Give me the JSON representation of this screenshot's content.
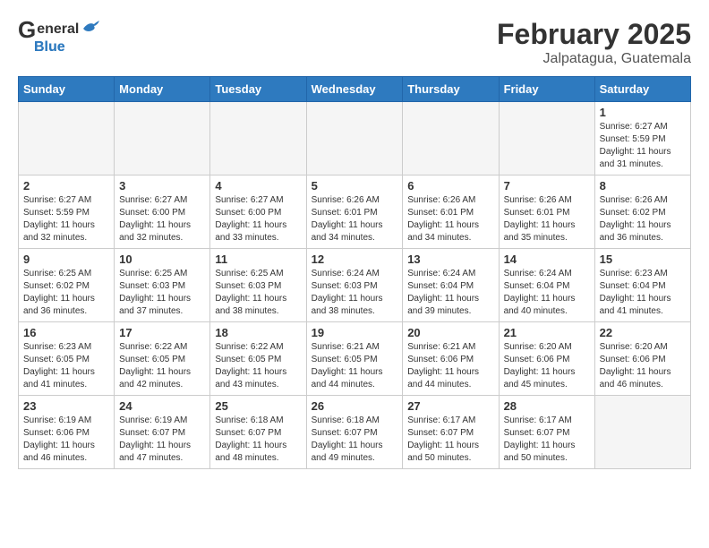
{
  "header": {
    "logo_general": "General",
    "logo_blue": "Blue",
    "month_year": "February 2025",
    "location": "Jalpatagua, Guatemala"
  },
  "days_of_week": [
    "Sunday",
    "Monday",
    "Tuesday",
    "Wednesday",
    "Thursday",
    "Friday",
    "Saturday"
  ],
  "weeks": [
    [
      {
        "day": "",
        "info": ""
      },
      {
        "day": "",
        "info": ""
      },
      {
        "day": "",
        "info": ""
      },
      {
        "day": "",
        "info": ""
      },
      {
        "day": "",
        "info": ""
      },
      {
        "day": "",
        "info": ""
      },
      {
        "day": "1",
        "info": "Sunrise: 6:27 AM\nSunset: 5:59 PM\nDaylight: 11 hours\nand 31 minutes."
      }
    ],
    [
      {
        "day": "2",
        "info": "Sunrise: 6:27 AM\nSunset: 5:59 PM\nDaylight: 11 hours\nand 32 minutes."
      },
      {
        "day": "3",
        "info": "Sunrise: 6:27 AM\nSunset: 6:00 PM\nDaylight: 11 hours\nand 32 minutes."
      },
      {
        "day": "4",
        "info": "Sunrise: 6:27 AM\nSunset: 6:00 PM\nDaylight: 11 hours\nand 33 minutes."
      },
      {
        "day": "5",
        "info": "Sunrise: 6:26 AM\nSunset: 6:01 PM\nDaylight: 11 hours\nand 34 minutes."
      },
      {
        "day": "6",
        "info": "Sunrise: 6:26 AM\nSunset: 6:01 PM\nDaylight: 11 hours\nand 34 minutes."
      },
      {
        "day": "7",
        "info": "Sunrise: 6:26 AM\nSunset: 6:01 PM\nDaylight: 11 hours\nand 35 minutes."
      },
      {
        "day": "8",
        "info": "Sunrise: 6:26 AM\nSunset: 6:02 PM\nDaylight: 11 hours\nand 36 minutes."
      }
    ],
    [
      {
        "day": "9",
        "info": "Sunrise: 6:25 AM\nSunset: 6:02 PM\nDaylight: 11 hours\nand 36 minutes."
      },
      {
        "day": "10",
        "info": "Sunrise: 6:25 AM\nSunset: 6:03 PM\nDaylight: 11 hours\nand 37 minutes."
      },
      {
        "day": "11",
        "info": "Sunrise: 6:25 AM\nSunset: 6:03 PM\nDaylight: 11 hours\nand 38 minutes."
      },
      {
        "day": "12",
        "info": "Sunrise: 6:24 AM\nSunset: 6:03 PM\nDaylight: 11 hours\nand 38 minutes."
      },
      {
        "day": "13",
        "info": "Sunrise: 6:24 AM\nSunset: 6:04 PM\nDaylight: 11 hours\nand 39 minutes."
      },
      {
        "day": "14",
        "info": "Sunrise: 6:24 AM\nSunset: 6:04 PM\nDaylight: 11 hours\nand 40 minutes."
      },
      {
        "day": "15",
        "info": "Sunrise: 6:23 AM\nSunset: 6:04 PM\nDaylight: 11 hours\nand 41 minutes."
      }
    ],
    [
      {
        "day": "16",
        "info": "Sunrise: 6:23 AM\nSunset: 6:05 PM\nDaylight: 11 hours\nand 41 minutes."
      },
      {
        "day": "17",
        "info": "Sunrise: 6:22 AM\nSunset: 6:05 PM\nDaylight: 11 hours\nand 42 minutes."
      },
      {
        "day": "18",
        "info": "Sunrise: 6:22 AM\nSunset: 6:05 PM\nDaylight: 11 hours\nand 43 minutes."
      },
      {
        "day": "19",
        "info": "Sunrise: 6:21 AM\nSunset: 6:05 PM\nDaylight: 11 hours\nand 44 minutes."
      },
      {
        "day": "20",
        "info": "Sunrise: 6:21 AM\nSunset: 6:06 PM\nDaylight: 11 hours\nand 44 minutes."
      },
      {
        "day": "21",
        "info": "Sunrise: 6:20 AM\nSunset: 6:06 PM\nDaylight: 11 hours\nand 45 minutes."
      },
      {
        "day": "22",
        "info": "Sunrise: 6:20 AM\nSunset: 6:06 PM\nDaylight: 11 hours\nand 46 minutes."
      }
    ],
    [
      {
        "day": "23",
        "info": "Sunrise: 6:19 AM\nSunset: 6:06 PM\nDaylight: 11 hours\nand 46 minutes."
      },
      {
        "day": "24",
        "info": "Sunrise: 6:19 AM\nSunset: 6:07 PM\nDaylight: 11 hours\nand 47 minutes."
      },
      {
        "day": "25",
        "info": "Sunrise: 6:18 AM\nSunset: 6:07 PM\nDaylight: 11 hours\nand 48 minutes."
      },
      {
        "day": "26",
        "info": "Sunrise: 6:18 AM\nSunset: 6:07 PM\nDaylight: 11 hours\nand 49 minutes."
      },
      {
        "day": "27",
        "info": "Sunrise: 6:17 AM\nSunset: 6:07 PM\nDaylight: 11 hours\nand 50 minutes."
      },
      {
        "day": "28",
        "info": "Sunrise: 6:17 AM\nSunset: 6:07 PM\nDaylight: 11 hours\nand 50 minutes."
      },
      {
        "day": "",
        "info": ""
      }
    ]
  ]
}
